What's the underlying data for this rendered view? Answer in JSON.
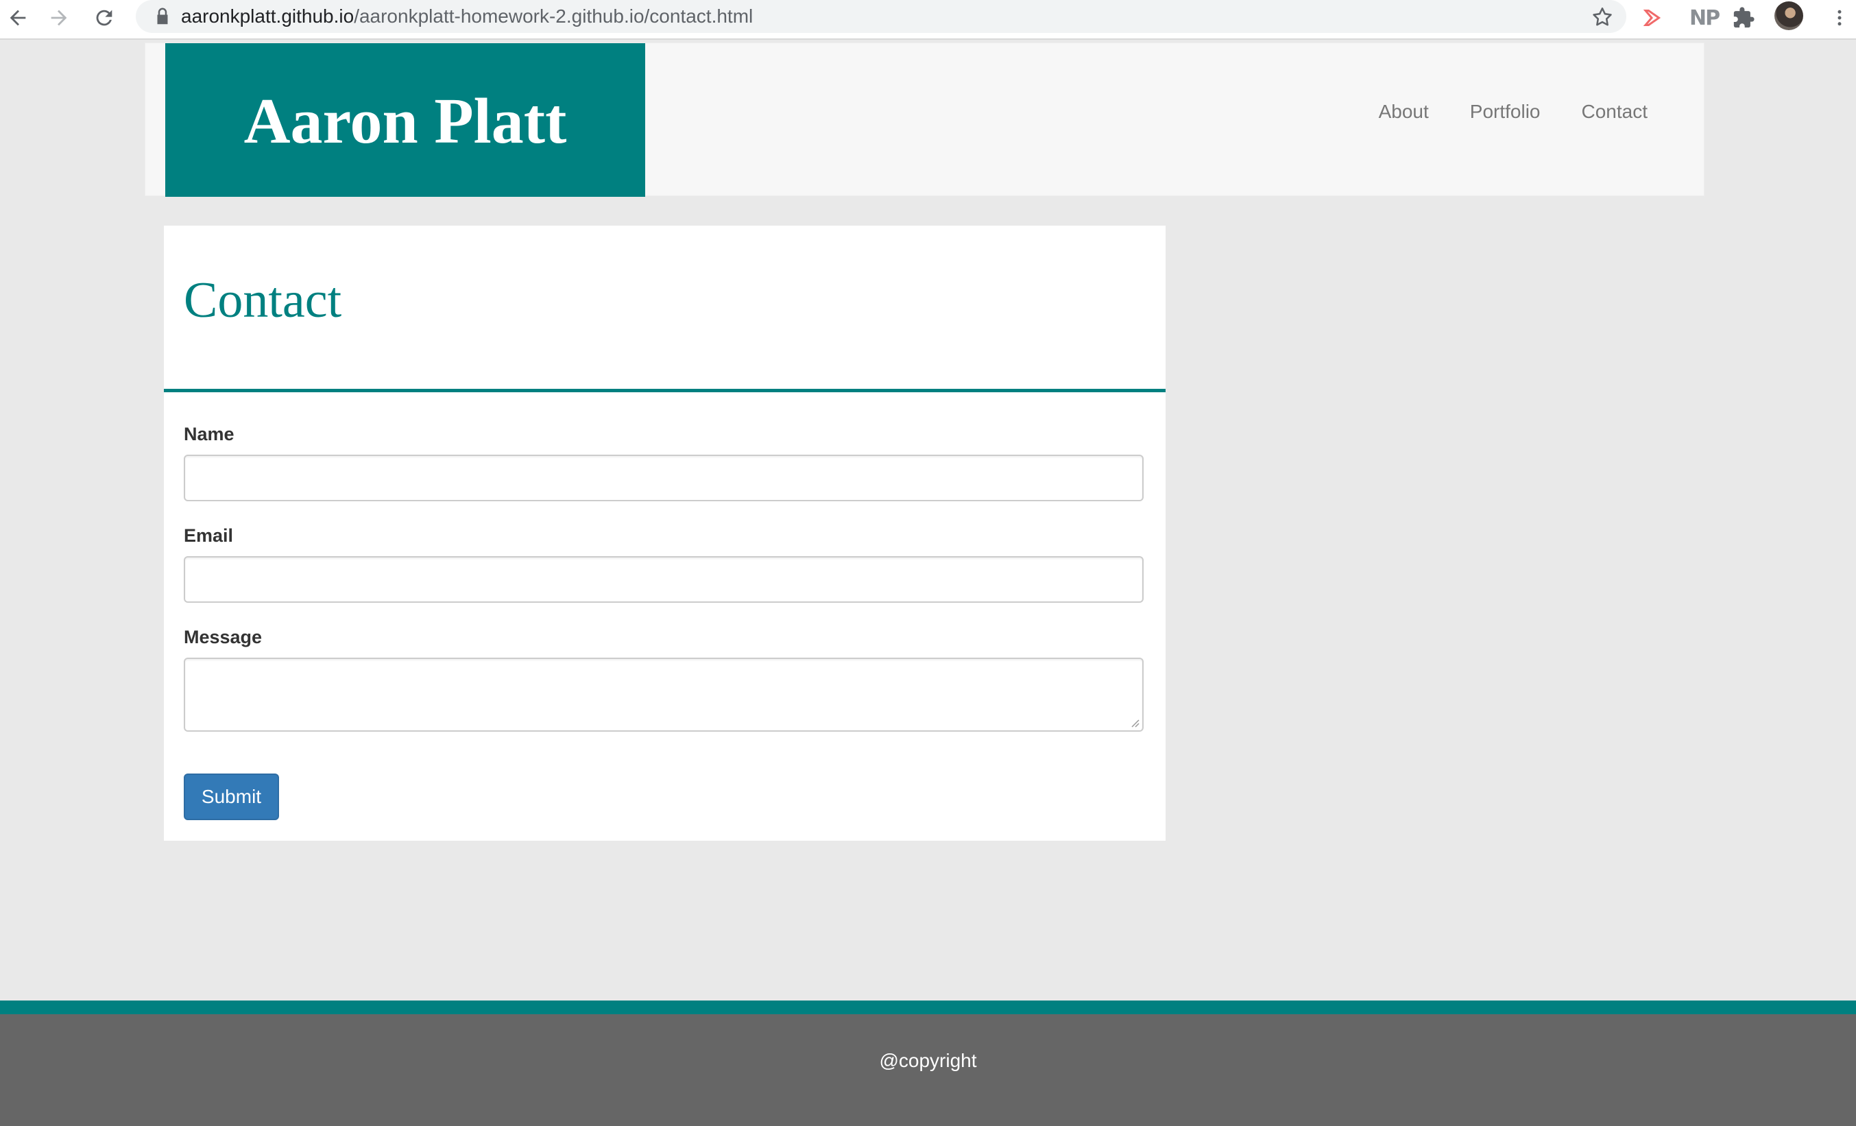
{
  "browser": {
    "url_host": "aaronkplatt.github.io",
    "url_path": "/aaronkplatt-homework-2.github.io/contact.html",
    "extensions": [
      "video-extension-icon",
      "NP",
      "puzzle-icon"
    ],
    "np_label": "NP"
  },
  "header": {
    "brand": "Aaron Platt",
    "nav": [
      {
        "label": "About"
      },
      {
        "label": "Portfolio"
      },
      {
        "label": "Contact"
      }
    ]
  },
  "contact": {
    "title": "Contact",
    "fields": [
      {
        "label": "Name",
        "value": ""
      },
      {
        "label": "Email",
        "value": ""
      },
      {
        "label": "Message",
        "value": ""
      }
    ],
    "submit_label": "Submit"
  },
  "footer": {
    "text": "@copyright"
  },
  "colors": {
    "accent": "#008080",
    "footer_bg": "#666666",
    "page_bg": "#e9e9e9",
    "button": "#337ab7"
  }
}
